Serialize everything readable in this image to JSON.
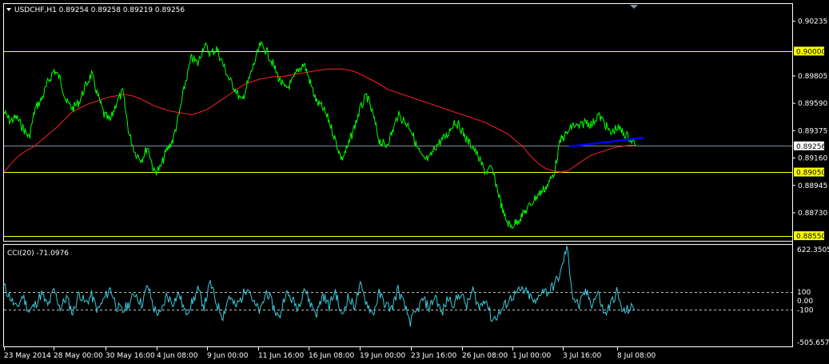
{
  "window": {
    "symbol_header": "USDCHF,H1  0.89254 0.89258 0.89219 0.89256",
    "indicator_header": "CCI(20) -71.0976"
  },
  "colors": {
    "background": "#000000",
    "frame": "#ffffff",
    "price": "#00ff00",
    "moving_average": "#ff2020",
    "level_lines": "#ffff00",
    "current_price_line": "#7f8fa0",
    "trendline": "#0000ff",
    "cci": "#40c8d8",
    "cci_levels": "#c0c0c0",
    "tag_bg_yellow": "#ffff00",
    "tag_bg_white": "#ffffff"
  },
  "chart_data": [
    {
      "type": "line",
      "title": "USDCHF,H1",
      "ylim": [
        0.8851,
        0.9037
      ],
      "y_ticks": [
        "0.90235",
        "0.89805",
        "0.89590",
        "0.89375",
        "0.89160",
        "0.88945",
        "0.88730"
      ],
      "x_ticks": [
        "23 May 2014",
        "28 May 00:00",
        "30 May 16:00",
        "4 Jun 08:00",
        "9 Jun 00:00",
        "11 Jun 16:00",
        "16 Jun 08:00",
        "19 Jun 00:00",
        "23 Jun 16:00",
        "26 Jun 08:00",
        "1 Jul 00:00",
        "3 Jul 16:00",
        "8 Jul 08:00"
      ],
      "price_tags": [
        {
          "value": 0.9,
          "label": "0.90000",
          "kind": "level"
        },
        {
          "value": 0.89256,
          "label": "0.89256",
          "kind": "current"
        },
        {
          "value": 0.8905,
          "label": "0.89050",
          "kind": "level"
        },
        {
          "value": 0.8855,
          "label": "0.88550",
          "kind": "level"
        }
      ],
      "series": [
        {
          "values": [
            0.8952,
            0.8945,
            0.8948,
            0.894,
            0.8932,
            0.8955,
            0.8962,
            0.8975,
            0.8985,
            0.8978,
            0.896,
            0.8955,
            0.896,
            0.8972,
            0.8982,
            0.8965,
            0.895,
            0.8945,
            0.896,
            0.8968,
            0.8935,
            0.892,
            0.8915,
            0.8925,
            0.8905,
            0.8908,
            0.8922,
            0.893,
            0.895,
            0.8975,
            0.8995,
            0.899,
            0.9005,
            0.8998,
            0.9002,
            0.899,
            0.8978,
            0.897,
            0.896,
            0.8975,
            0.899,
            0.9005,
            0.9,
            0.899,
            0.8978,
            0.897,
            0.8975,
            0.8985,
            0.899,
            0.8975,
            0.896,
            0.8955,
            0.8945,
            0.893,
            0.8915,
            0.8925,
            0.894,
            0.8955,
            0.8965,
            0.895,
            0.893,
            0.8925,
            0.8935,
            0.895,
            0.8945,
            0.894,
            0.8925,
            0.8915,
            0.8915,
            0.8925,
            0.893,
            0.8935,
            0.8945,
            0.894,
            0.893,
            0.8925,
            0.8915,
            0.8905,
            0.8908,
            0.889,
            0.887,
            0.8862,
            0.8866,
            0.8872,
            0.8878,
            0.8885,
            0.889,
            0.8895,
            0.8905,
            0.893,
            0.8935,
            0.8942,
            0.894,
            0.8945,
            0.8942,
            0.895,
            0.8944,
            0.8935,
            0.894,
            0.8936,
            0.8932,
            0.8926
          ]
        },
        {
          "name": "",
          "values": [
            0.8905,
            0.8912,
            0.8918,
            0.8922,
            0.8925,
            0.893,
            0.8935,
            0.894,
            0.8946,
            0.8952,
            0.8955,
            0.8958,
            0.896,
            0.8962,
            0.8964,
            0.8965,
            0.8966,
            0.8965,
            0.8963,
            0.896,
            0.8957,
            0.8955,
            0.8953,
            0.8952,
            0.8951,
            0.895,
            0.8952,
            0.8954,
            0.8958,
            0.8962,
            0.8966,
            0.897,
            0.8974,
            0.8976,
            0.8978,
            0.8979,
            0.898,
            0.898,
            0.8981,
            0.8982,
            0.8983,
            0.8984,
            0.8985,
            0.8986,
            0.8986,
            0.8986,
            0.8985,
            0.8983,
            0.898,
            0.8977,
            0.8974,
            0.897,
            0.8968,
            0.8966,
            0.8964,
            0.8962,
            0.896,
            0.8958,
            0.8956,
            0.8954,
            0.8952,
            0.895,
            0.8948,
            0.8946,
            0.8944,
            0.8941,
            0.8938,
            0.8935,
            0.893,
            0.8925,
            0.8918,
            0.8912,
            0.8908,
            0.8906,
            0.8905,
            0.8906,
            0.891,
            0.8914,
            0.8918,
            0.892,
            0.8922,
            0.8924,
            0.8925,
            0.8926,
            0.8926
          ]
        }
      ],
      "trendline": {
        "x": [
          0.707,
          0.805
        ],
        "y": [
          0.8925,
          0.8932
        ]
      }
    },
    {
      "type": "line",
      "title": "CCI(20)",
      "ylim": [
        -505.6573,
        622.3505
      ],
      "y_ticks": [
        "622.3505",
        "100",
        "0.00",
        "-100",
        "-505.6573"
      ],
      "levels": [
        100,
        -100
      ],
      "series": [
        {
          "values": [
            160,
            40,
            -90,
            60,
            -120,
            -40,
            80,
            -60,
            120,
            -80,
            40,
            -140,
            90,
            -30,
            60,
            -110,
            20,
            140,
            -60,
            -120,
            -30,
            90,
            -40,
            170,
            -90,
            -160,
            60,
            -20,
            80,
            -140,
            -30,
            120,
            -60,
            200,
            -30,
            -170,
            60,
            -70,
            30,
            180,
            -40,
            -120,
            110,
            -50,
            -200,
            90,
            20,
            -80,
            150,
            -30,
            -140,
            70,
            -60,
            110,
            -180,
            40,
            -60,
            160,
            -20,
            -150,
            80,
            -40,
            -90,
            130,
            -50,
            -230,
            -120,
            20,
            -80,
            60,
            -150,
            30,
            -30,
            90,
            -60,
            120,
            -80,
            40,
            -210,
            -160,
            -60,
            30,
            90,
            120,
            60,
            -40,
            130,
            90,
            180,
            300,
            600,
            40,
            -60,
            110,
            -30,
            90,
            -160,
            -40,
            100,
            -130,
            -90,
            -70
          ]
        }
      ]
    }
  ]
}
